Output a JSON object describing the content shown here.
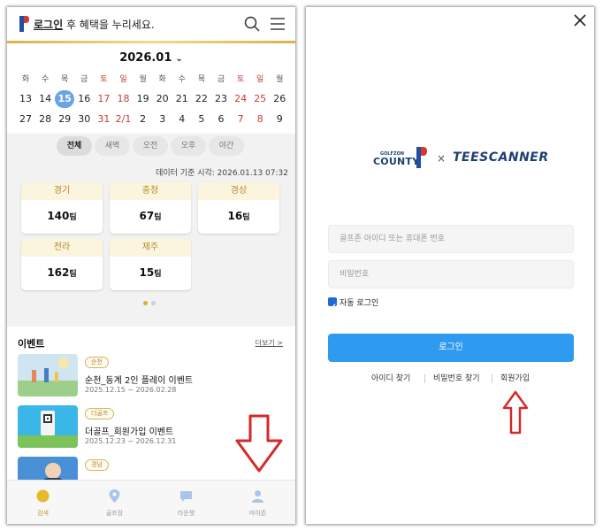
{
  "colors": {
    "accent_gold": "#d9b44a",
    "holiday_red": "#c93b3b",
    "selected_blue": "#6aa3e6",
    "login_blue": "#2f9bf0",
    "arrow_red": "#d42a2a"
  },
  "left": {
    "header": {
      "login_link": "로그인",
      "login_suffix": " 후 혜택을 누리세요.",
      "search_icon": "search-icon",
      "menu_icon": "hamburger-icon"
    },
    "calendar": {
      "month": "2026.01",
      "weekdays": [
        {
          "label": "화",
          "red": false
        },
        {
          "label": "수",
          "red": false
        },
        {
          "label": "목",
          "red": false
        },
        {
          "label": "금",
          "red": false
        },
        {
          "label": "토",
          "red": true
        },
        {
          "label": "일",
          "red": true
        },
        {
          "label": "월",
          "red": false
        },
        {
          "label": "화",
          "red": false
        },
        {
          "label": "수",
          "red": false
        },
        {
          "label": "목",
          "red": false
        },
        {
          "label": "금",
          "red": false
        },
        {
          "label": "토",
          "red": true
        },
        {
          "label": "일",
          "red": true
        },
        {
          "label": "월",
          "red": false
        }
      ],
      "week1": [
        {
          "d": "13",
          "red": false
        },
        {
          "d": "14",
          "red": false
        },
        {
          "d": "15",
          "red": false,
          "selected": true
        },
        {
          "d": "16",
          "red": false
        },
        {
          "d": "17",
          "red": true
        },
        {
          "d": "18",
          "red": true
        },
        {
          "d": "19",
          "red": false
        },
        {
          "d": "20",
          "red": false
        },
        {
          "d": "21",
          "red": false
        },
        {
          "d": "22",
          "red": false
        },
        {
          "d": "23",
          "red": false
        },
        {
          "d": "24",
          "red": true
        },
        {
          "d": "25",
          "red": true
        },
        {
          "d": "26",
          "red": false
        }
      ],
      "week2": [
        {
          "d": "27",
          "red": false
        },
        {
          "d": "28",
          "red": false
        },
        {
          "d": "29",
          "red": false
        },
        {
          "d": "30",
          "red": false
        },
        {
          "d": "31",
          "red": true
        },
        {
          "d": "2/1",
          "red": true
        },
        {
          "d": "2",
          "red": false
        },
        {
          "d": "3",
          "red": false
        },
        {
          "d": "4",
          "red": false
        },
        {
          "d": "5",
          "red": false
        },
        {
          "d": "6",
          "red": false
        },
        {
          "d": "7",
          "red": true
        },
        {
          "d": "8",
          "red": true
        },
        {
          "d": "9",
          "red": false
        }
      ]
    },
    "filters": [
      "전체",
      "새벽",
      "오전",
      "오후",
      "야간"
    ],
    "basis_text": "데이터 기준 시각: 2026.01.13 07:32",
    "regions": [
      {
        "name": "경기",
        "value": "140",
        "unit": "팀"
      },
      {
        "name": "충청",
        "value": "67",
        "unit": "팀"
      },
      {
        "name": "경상",
        "value": "16",
        "unit": "팀"
      },
      {
        "name": "전라",
        "value": "162",
        "unit": "팀"
      },
      {
        "name": "제주",
        "value": "15",
        "unit": "팀"
      }
    ],
    "pager": {
      "pages": 2,
      "current": 1
    },
    "events": {
      "title": "이벤트",
      "more": "더보기 >",
      "items": [
        {
          "tag": "순천",
          "name": "순천_동계 2인 플레이 이벤트",
          "date": "2025.12.15 ~ 2026.02.28"
        },
        {
          "tag": "더골프",
          "name": "더골프_회원가입 이벤트",
          "date": "2025.12.23 ~ 2026.12.31"
        },
        {
          "tag": "경남",
          "name": "",
          "date": ""
        }
      ]
    },
    "nav": [
      {
        "label": "검색",
        "icon": "search-circle-icon",
        "active": true
      },
      {
        "label": "골프장",
        "icon": "location-pin-icon",
        "active": false
      },
      {
        "label": "라운젯",
        "icon": "chat-bubble-icon",
        "active": false
      },
      {
        "label": "마이존",
        "icon": "person-icon",
        "active": false
      }
    ]
  },
  "right": {
    "brand": {
      "golfzon_small": "GOLFZON",
      "county": "COUNTY",
      "times": "×",
      "teescanner": "TEESCANNER"
    },
    "id_placeholder": "골프존 아이디 또는 휴대폰 번호",
    "pw_placeholder": "비밀번호",
    "auto_login": "자동 로그인",
    "auto_login_checked": true,
    "login_button": "로그인",
    "links": [
      "아이디 찾기",
      "비밀번호 찾기",
      "회원가입"
    ]
  }
}
